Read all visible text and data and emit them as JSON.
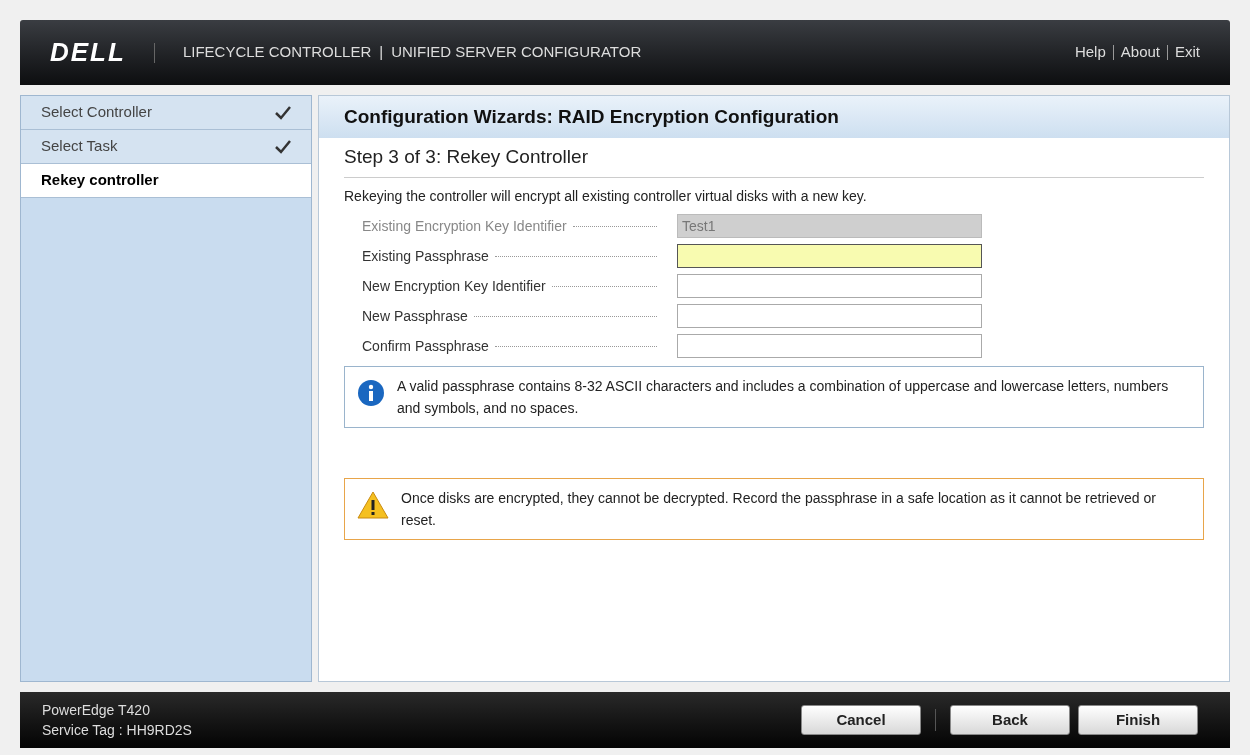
{
  "header": {
    "logo": "DELL",
    "title": "LIFECYCLE CONTROLLER",
    "separator": "|",
    "subtitle": "UNIFIED SERVER CONFIGURATOR",
    "links": [
      "Help",
      "About",
      "Exit"
    ]
  },
  "steps": [
    {
      "label": "Select Controller",
      "completed": true,
      "selected": false
    },
    {
      "label": "Select Task",
      "completed": true,
      "selected": false
    },
    {
      "label": "Rekey controller",
      "completed": false,
      "selected": true
    }
  ],
  "main": {
    "title": "Configuration Wizards: RAID Encryption Configuration",
    "step_title": "Step 3 of 3: Rekey Controller",
    "description": "Rekeying the controller will encrypt all existing controller virtual disks with a new key.",
    "fields": [
      {
        "label": "Existing Encryption Key Identifier",
        "value": "Test1",
        "disabled": true,
        "focused": false
      },
      {
        "label": "Existing Passphrase",
        "disabled": false,
        "focused": true
      },
      {
        "label": "New Encryption Key Identifier",
        "disabled": false,
        "focused": false
      },
      {
        "label": "New Passphrase",
        "disabled": false,
        "focused": false
      },
      {
        "label": "Confirm Passphrase",
        "disabled": false,
        "focused": false
      }
    ],
    "messages": [
      {
        "kind": "info",
        "text": "A valid passphrase contains 8-32 ASCII characters and includes a combination of uppercase and lowercase letters, numbers and symbols, and no spaces."
      },
      {
        "kind": "warning",
        "text": "Once disks are encrypted, they cannot be decrypted. Record the passphrase in a safe location as it cannot be retrieved or reset."
      }
    ]
  },
  "footer": {
    "model": "PowerEdge T420",
    "service_tag": "Service Tag : HH9RD2S",
    "buttons": [
      "Cancel",
      "Back",
      "Finish"
    ]
  }
}
